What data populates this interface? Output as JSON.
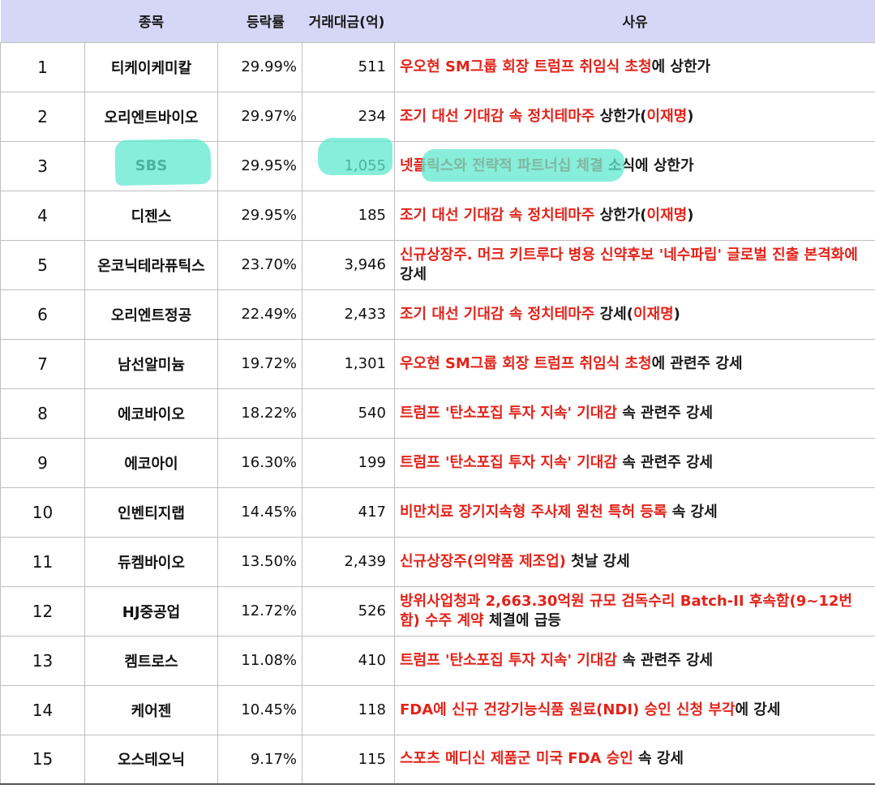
{
  "headers": {
    "name": "종목",
    "rate": "등락률",
    "volume": "거래대금(억)",
    "reason": "사유"
  },
  "rows": [
    {
      "rank": "1",
      "name": "티케이케미칼",
      "rate": "29.99%",
      "volume": "511",
      "reason": [
        {
          "t": "우오현 SM그룹 회장 트럼프 취임식 초청",
          "c": "red"
        },
        {
          "t": "에 상한가",
          "c": "black"
        }
      ]
    },
    {
      "rank": "2",
      "name": "오리엔트바이오",
      "rate": "29.97%",
      "volume": "234",
      "reason": [
        {
          "t": "조기 대선 기대감 속 정치테마주",
          "c": "red"
        },
        {
          "t": " 상한가(",
          "c": "black"
        },
        {
          "t": "이재명",
          "c": "red"
        },
        {
          "t": ")",
          "c": "black"
        }
      ]
    },
    {
      "rank": "3",
      "name": "SBS",
      "rate": "29.95%",
      "volume": "1,055",
      "reason": [
        {
          "t": "넷플릭스와 전략적 파트너십 체결",
          "c": "red"
        },
        {
          "t": " 소식에 상한가",
          "c": "black"
        }
      ]
    },
    {
      "rank": "4",
      "name": "디젠스",
      "rate": "29.95%",
      "volume": "185",
      "reason": [
        {
          "t": "조기 대선 기대감 속 정치테마주",
          "c": "red"
        },
        {
          "t": " 상한가(",
          "c": "black"
        },
        {
          "t": "이재명",
          "c": "red"
        },
        {
          "t": ")",
          "c": "black"
        }
      ]
    },
    {
      "rank": "5",
      "name": "온코닉테라퓨틱스",
      "rate": "23.70%",
      "volume": "3,946",
      "reason": [
        {
          "t": "신규상장주. 머크 키트루다 병용 신약후보 '네수파립' 글로벌 진출 본격화에",
          "c": "red"
        },
        {
          "t": " 강세",
          "c": "black"
        }
      ]
    },
    {
      "rank": "6",
      "name": "오리엔트정공",
      "rate": "22.49%",
      "volume": "2,433",
      "reason": [
        {
          "t": "조기 대선 기대감 속 정치테마주",
          "c": "red"
        },
        {
          "t": " 강세(",
          "c": "black"
        },
        {
          "t": "이재명",
          "c": "red"
        },
        {
          "t": ")",
          "c": "black"
        }
      ]
    },
    {
      "rank": "7",
      "name": "남선알미늄",
      "rate": "19.72%",
      "volume": "1,301",
      "reason": [
        {
          "t": "우오현 SM그룹 회장 트럼프 취임식 초청",
          "c": "red"
        },
        {
          "t": "에 관련주 강세",
          "c": "black"
        }
      ]
    },
    {
      "rank": "8",
      "name": "에코바이오",
      "rate": "18.22%",
      "volume": "540",
      "reason": [
        {
          "t": "트럼프 '탄소포집 투자 지속' 기대감",
          "c": "red"
        },
        {
          "t": " 속 관련주 강세",
          "c": "black"
        }
      ]
    },
    {
      "rank": "9",
      "name": "에코아이",
      "rate": "16.30%",
      "volume": "199",
      "reason": [
        {
          "t": "트럼프 '탄소포집 투자 지속' 기대감",
          "c": "red"
        },
        {
          "t": " 속 관련주 강세",
          "c": "black"
        }
      ]
    },
    {
      "rank": "10",
      "name": "인벤티지랩",
      "rate": "14.45%",
      "volume": "417",
      "reason": [
        {
          "t": "비만치료 장기지속형 주사제 원천 특허 등록",
          "c": "red"
        },
        {
          "t": " 속 강세",
          "c": "black"
        }
      ]
    },
    {
      "rank": "11",
      "name": "듀켐바이오",
      "rate": "13.50%",
      "volume": "2,439",
      "reason": [
        {
          "t": "신규상장주(의약품 제조업)",
          "c": "red"
        },
        {
          "t": " 첫날 강세",
          "c": "black"
        }
      ]
    },
    {
      "rank": "12",
      "name": "HJ중공업",
      "rate": "12.72%",
      "volume": "526",
      "reason": [
        {
          "t": "방위사업청과 2,663.30억원 규모 검독수리 Batch-II 후속함(9~12번함) 수주 계약",
          "c": "red"
        },
        {
          "t": " 체결에 급등",
          "c": "black"
        }
      ]
    },
    {
      "rank": "13",
      "name": "켐트로스",
      "rate": "11.08%",
      "volume": "410",
      "reason": [
        {
          "t": "트럼프 '탄소포집 투자 지속' 기대감",
          "c": "red"
        },
        {
          "t": " 속 관련주 강세",
          "c": "black"
        }
      ]
    },
    {
      "rank": "14",
      "name": "케어젠",
      "rate": "10.45%",
      "volume": "118",
      "reason": [
        {
          "t": "FDA에 신규 건강기능식품 원료(NDI) 승인 신청 부각",
          "c": "red"
        },
        {
          "t": "에 강세",
          "c": "black"
        }
      ]
    },
    {
      "rank": "15",
      "name": "오스테오닉",
      "rate": "9.17%",
      "volume": "115",
      "reason": [
        {
          "t": "스포츠 메디신 제품군 미국 FDA 승인",
          "c": "red"
        },
        {
          "t": " 속 강세",
          "c": "black"
        }
      ]
    }
  ],
  "colors": {
    "header_bg": "#d6d6f6",
    "reason_highlight": "#e2231a",
    "marker_highlight": "#5fe8cf"
  }
}
